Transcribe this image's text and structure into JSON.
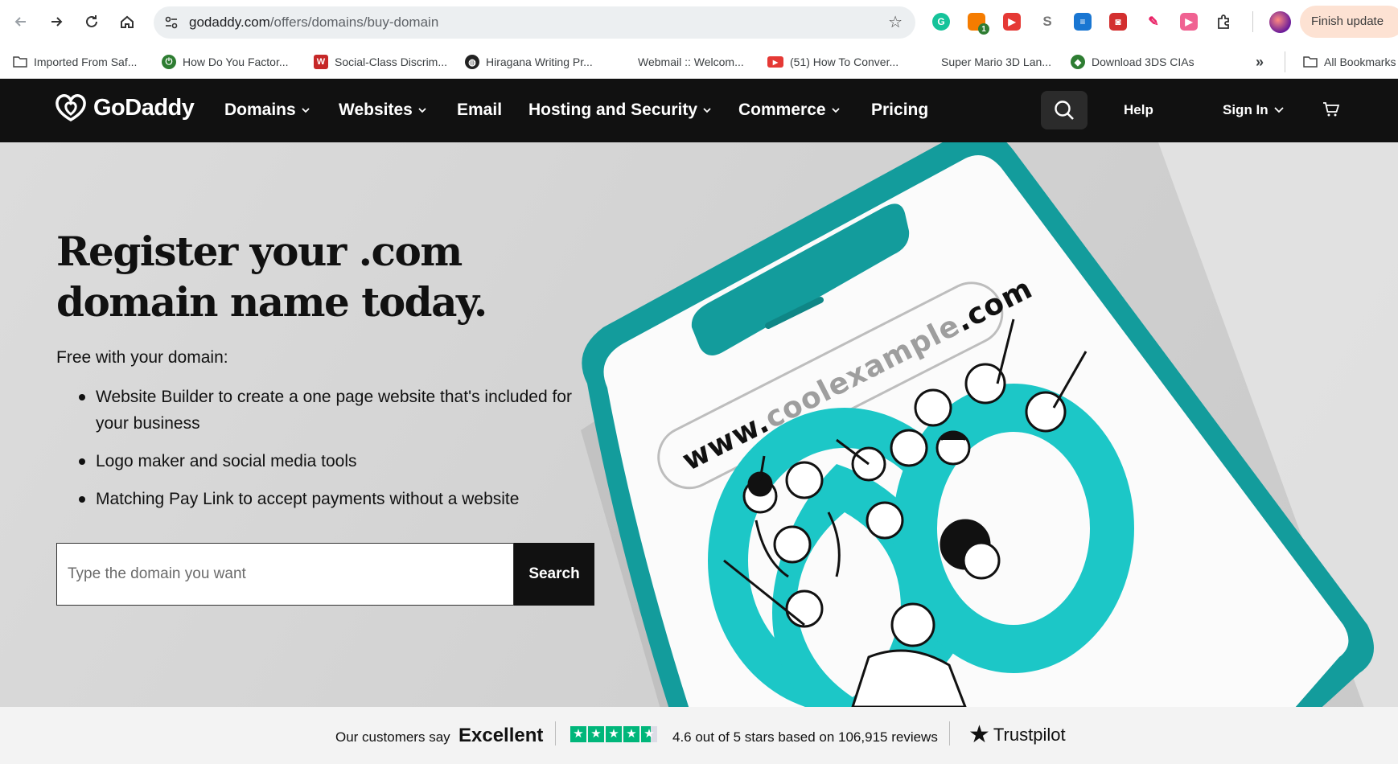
{
  "browser": {
    "url_host": "godaddy.com",
    "url_path": "/offers/domains/buy-domain",
    "update_button": "Finish update",
    "extension_badge": "1",
    "bookmarks": [
      {
        "label": "Imported From Saf...",
        "icon": "folder-icon"
      },
      {
        "label": "How Do You Factor...",
        "icon": "power-icon"
      },
      {
        "label": "Social-Class Discrim...",
        "icon": "w-logo-icon"
      },
      {
        "label": "Hiragana Writing Pr...",
        "icon": "globe-icon"
      },
      {
        "label": "Webmail :: Welcom...",
        "icon": "none"
      },
      {
        "label": "(51) How To Conver...",
        "icon": "youtube-icon"
      },
      {
        "label": "Super Mario 3D Lan...",
        "icon": "none"
      },
      {
        "label": "Download 3DS CIAs",
        "icon": "3ds-icon"
      }
    ],
    "more_bookmarks": "»",
    "all_bookmarks": "All Bookmarks"
  },
  "nav": {
    "brand": "GoDaddy",
    "items": [
      {
        "label": "Domains",
        "dropdown": true
      },
      {
        "label": "Websites",
        "dropdown": true
      },
      {
        "label": "Email",
        "dropdown": false
      },
      {
        "label": "Hosting and Security",
        "dropdown": true
      },
      {
        "label": "Commerce",
        "dropdown": true
      },
      {
        "label": "Pricing",
        "dropdown": false
      }
    ],
    "help": "Help",
    "sign_in": "Sign In"
  },
  "hero": {
    "title_line1": "Register your .com",
    "title_line2": "domain name today.",
    "subtitle": "Free with your domain:",
    "features": [
      "Website Builder to create a one page website that's included for your business",
      "Logo maker and social media tools",
      "Matching Pay Link to accept payments without a website"
    ],
    "search_placeholder": "Type the domain you want",
    "search_button": "Search",
    "phone_text": "www.coolexample.com"
  },
  "trust": {
    "customers_say": "Our customers say",
    "verdict": "Excellent",
    "rating_text": "4.6 out of 5 stars based on 106,915 reviews",
    "stars": 4.6,
    "brand": "Trustpilot"
  },
  "colors": {
    "nav_bg": "#111111",
    "accent_teal": "#1bbfbf",
    "phone_teal": "#14a3a3",
    "trust_green": "#00b67a"
  }
}
